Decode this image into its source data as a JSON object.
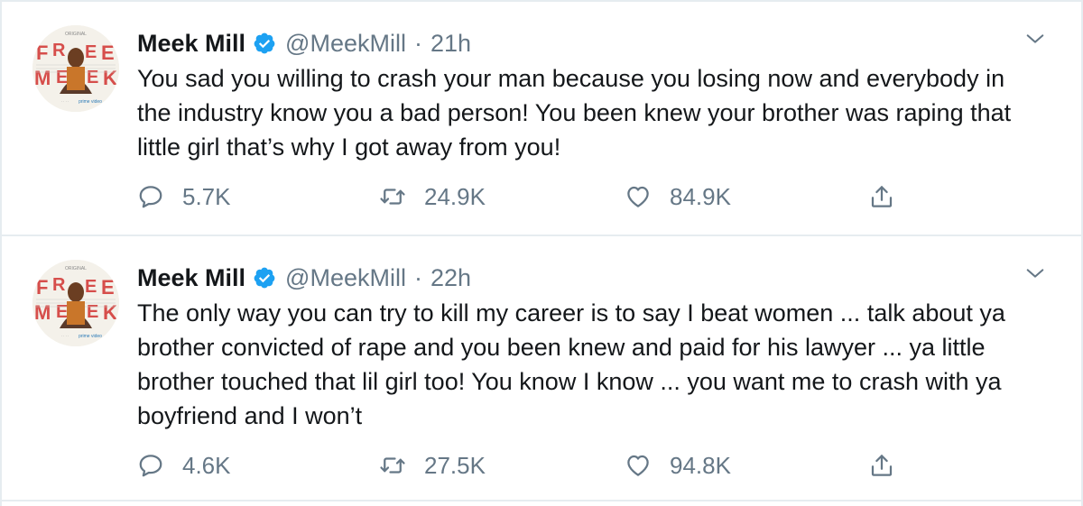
{
  "tweets": [
    {
      "author_name": "Meek Mill",
      "handle": "@MeekMill",
      "separator": "·",
      "time": "21h",
      "text": "You sad you willing to crash your man because you losing now and everybody in the industry know you a bad person! You been knew your brother was raping that little girl that’s why I got away from you!",
      "replies": "5.7K",
      "retweets": "24.9K",
      "likes": "84.9K"
    },
    {
      "author_name": "Meek Mill",
      "handle": "@MeekMill",
      "separator": "·",
      "time": "22h",
      "text": "The only way you can try to kill my career is to say I beat women ... talk about ya brother convicted of rape and you been knew and paid for his lawyer ... ya little brother touched that lil girl too! You know I know ... you want me to crash with ya boyfriend and I won’t",
      "replies": "4.6K",
      "retweets": "27.5K",
      "likes": "94.8K"
    }
  ],
  "avatar": {
    "top_text": "ORIGINAL",
    "main_text": "FREE MEEK",
    "brand_text": "prime video"
  },
  "colors": {
    "text": "#14171a",
    "secondary": "#657786",
    "verified": "#1da1f2",
    "divider": "#e6ecf0",
    "avatar_red": "#d1322f"
  },
  "icons": [
    "verified-badge-icon",
    "chevron-down-icon",
    "reply-icon",
    "retweet-icon",
    "like-icon",
    "share-icon"
  ]
}
